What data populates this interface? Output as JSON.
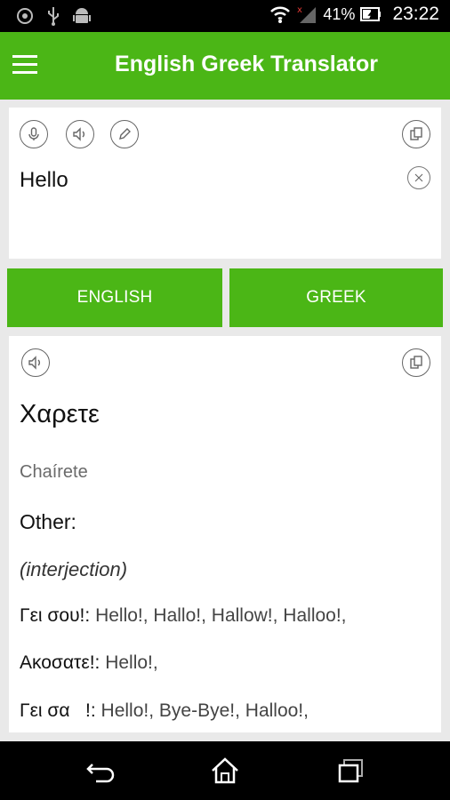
{
  "status_bar": {
    "battery_text": "41%",
    "time": "23:22",
    "icons": [
      "shield-icon",
      "usb-icon",
      "android-icon",
      "wifi-icon",
      "signal-icon",
      "battery-icon"
    ]
  },
  "app_bar": {
    "title": "English Greek Translator",
    "menu_icon": "menu-icon"
  },
  "input": {
    "text": "Hello",
    "icons": [
      "microphone-icon",
      "speaker-icon",
      "pen-icon",
      "copy-icon",
      "clear-icon"
    ]
  },
  "languages": {
    "source": "ENGLISH",
    "target": "GREEK"
  },
  "output": {
    "translation": "Χαρετε",
    "transliteration": "Chaírete",
    "other_label": "Other:",
    "part_of_speech": "(interjection)",
    "definitions": [
      {
        "term": "Γει σου!: ",
        "meanings": "Hello!, Hallo!, Hallow!, Halloo!,"
      },
      {
        "term": "Ακοσατε!: ",
        "meanings": "Hello!,"
      },
      {
        "term": "Γει σα   !: ",
        "meanings": "Hello!, Bye-Bye!, Halloo!,"
      }
    ],
    "icons": [
      "speaker-icon",
      "copy-icon"
    ]
  },
  "colors": {
    "primary": "#4bb616",
    "status_bar": "#000000",
    "background": "#e9e9e9",
    "card": "#ffffff"
  },
  "nav_bar": {
    "icons": [
      "back-icon",
      "home-icon",
      "recents-icon"
    ]
  }
}
